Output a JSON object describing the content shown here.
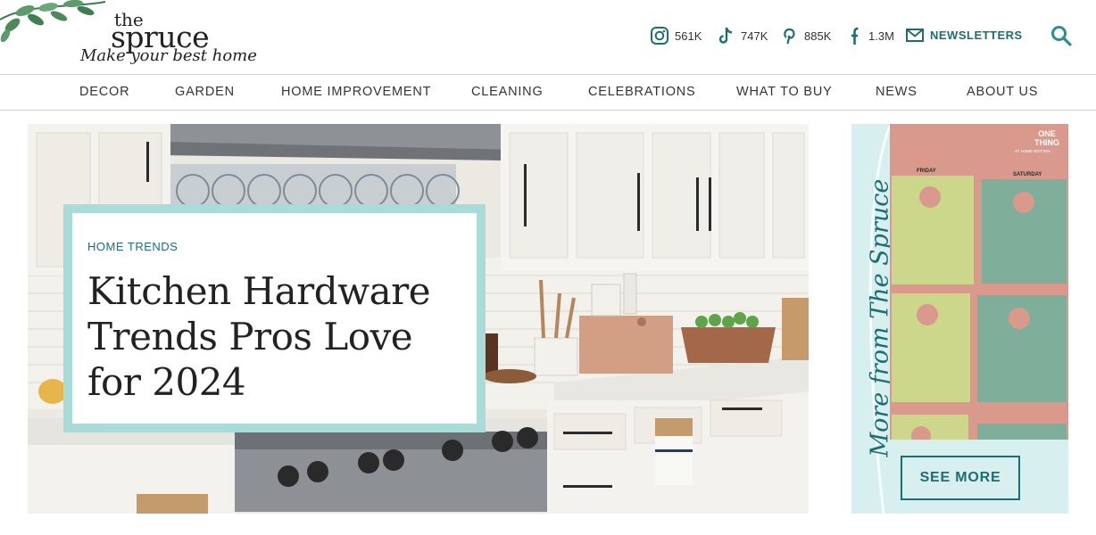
{
  "brand": {
    "logo_top": "the",
    "logo_main": "spruce",
    "tagline": "Make your best home"
  },
  "social": [
    {
      "icon": "instagram-icon",
      "count": "561K"
    },
    {
      "icon": "tiktok-icon",
      "count": "747K"
    },
    {
      "icon": "pinterest-icon",
      "count": "885K"
    },
    {
      "icon": "facebook-icon",
      "count": "1.3M"
    }
  ],
  "header": {
    "newsletters_label": "NEWSLETTERS"
  },
  "nav": {
    "items": [
      "DECOR",
      "GARDEN",
      "HOME IMPROVEMENT",
      "CLEANING",
      "CELEBRATIONS",
      "WHAT TO BUY",
      "NEWS",
      "ABOUT US"
    ]
  },
  "hero": {
    "kicker": "HOME TRENDS",
    "headline": "Kitchen Hardware Trends Pros Love for 2024"
  },
  "promo": {
    "vertical_text": "More from The Spruce",
    "image_text_brand": "ONE THING",
    "image_text_edition": "AT HOME EDITION",
    "image_label_left": "FRIDAY",
    "image_label_right": "SATURDAY",
    "button_label": "SEE MORE"
  },
  "colors": {
    "accent": "#1b6f73",
    "accent_light": "#a9dbd9",
    "promo_bg": "#d7efee",
    "divider": "#b9dcdc"
  }
}
